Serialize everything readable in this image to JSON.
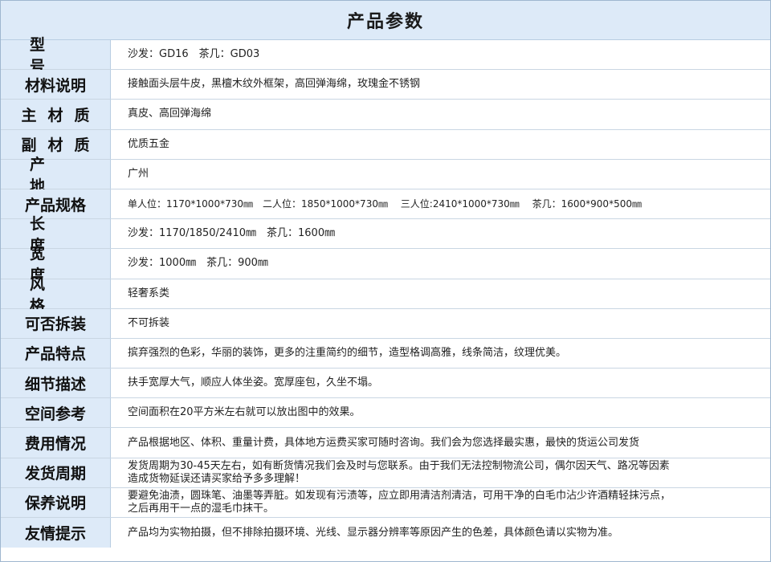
{
  "title": "产品参数",
  "rows": [
    {
      "label": "型号",
      "value": "沙发：GD16　茶几：GD03"
    },
    {
      "label": "材料说明",
      "value": "接触面头层牛皮，黑檀木纹外框架，高回弹海绵，玫瑰金不锈钢"
    },
    {
      "label": "主材质",
      "value": "真皮、高回弹海绵"
    },
    {
      "label": "副材质",
      "value": "优质五金"
    },
    {
      "label": "产地",
      "value": "广州"
    },
    {
      "label": "产品规格",
      "value": "单人位：1170*1000*730㎜　二人位：1850*1000*730㎜　 三人位:2410*1000*730㎜　 茶几：1600*900*500㎜"
    },
    {
      "label": "长度",
      "value": "沙发：1170/1850/2410㎜　茶几：1600㎜"
    },
    {
      "label": "宽度",
      "value": "沙发：1000㎜　茶几：900㎜"
    },
    {
      "label": "风格",
      "value": "轻奢系类"
    },
    {
      "label": "可否拆装",
      "value": "不可拆装"
    },
    {
      "label": "产品特点",
      "value": "摈弃强烈的色彩，华丽的装饰，更多的注重简约的细节，造型格调高雅，线条简洁，纹理优美。"
    },
    {
      "label": "细节描述",
      "value": "扶手宽厚大气，顺应人体坐姿。宽厚座包，久坐不塌。"
    },
    {
      "label": "空间参考",
      "value": "空间面积在20平方米左右就可以放出图中的效果。"
    },
    {
      "label": "费用情况",
      "value": "产品根据地区、体积、重量计费，具体地方运费买家可随时咨询。我们会为您选择最实惠，最快的货运公司发货"
    },
    {
      "label": "发货周期",
      "value": "发货周期为30-45天左右，如有断货情况我们会及时与您联系。由于我们无法控制物流公司，偶尔因天气、路况等因素",
      "value2": "造成货物延误还请买家给予多多理解！"
    },
    {
      "label": "保养说明",
      "value": "要避免油渍，圆珠笔、油墨等弄脏。如发现有污渍等，应立即用清洁剂清洁，可用干净的白毛巾沾少许酒精轻抹污点，",
      "value2": "之后再用干一点的湿毛巾抹干。"
    },
    {
      "label": "友情提示",
      "value": "产品均为实物拍摄，但不排除拍摄环境、光线、显示器分辨率等原因产生的色差，具体颜色请以实物为准。"
    }
  ]
}
